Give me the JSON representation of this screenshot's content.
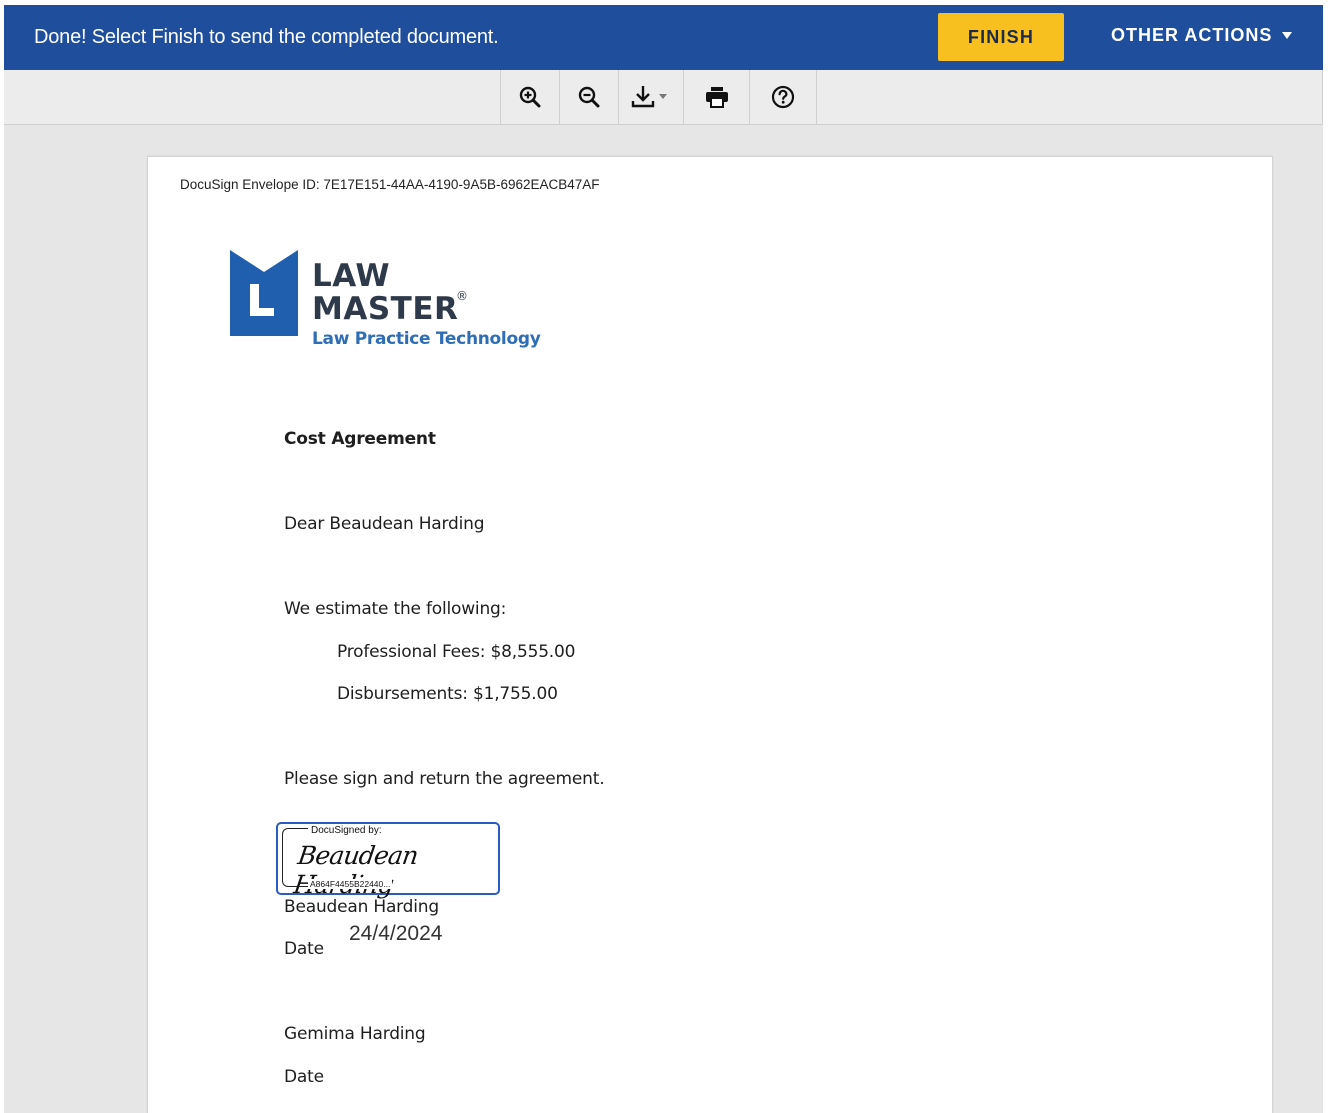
{
  "banner": {
    "message": "Done! Select Finish to send the completed document.",
    "finish_label": "FINISH",
    "other_actions_label": "OTHER ACTIONS"
  },
  "toolbar": {
    "tools": [
      {
        "name": "zoom-in-icon"
      },
      {
        "name": "zoom-out-icon"
      },
      {
        "name": "download-icon"
      },
      {
        "name": "print-icon"
      },
      {
        "name": "help-icon"
      }
    ]
  },
  "document": {
    "envelope_id": "DocuSign Envelope ID: 7E17E151-44AA-4190-9A5B-6962EACB47AF",
    "logo": {
      "line1": "LAW",
      "line2": "MASTER",
      "registered": "®",
      "tagline": "Law Practice Technology"
    },
    "title": "Cost Agreement",
    "greeting": "Dear Beaudean Harding",
    "estimate_intro": "We estimate the following:",
    "fees_line": "Professional Fees: $8,555.00",
    "disbursements_line": "Disbursements: $1,755.00",
    "sign_request": "Please sign and return the agreement.",
    "signature": {
      "label": "DocuSigned by:",
      "script": "Beaudean Harding",
      "hash": "A864F4455B22440..."
    },
    "signer1_name": "Beaudean Harding",
    "signer1_date_label": "Date",
    "signer1_date_value": "24/4/2024",
    "signer2_name": "Gemima Harding",
    "signer2_date_label": "Date"
  },
  "colors": {
    "banner": "#1f4e9c",
    "finish_button": "#f7c01f",
    "logo_blue": "#1f5fae",
    "signature_border": "#2a5bc2"
  }
}
